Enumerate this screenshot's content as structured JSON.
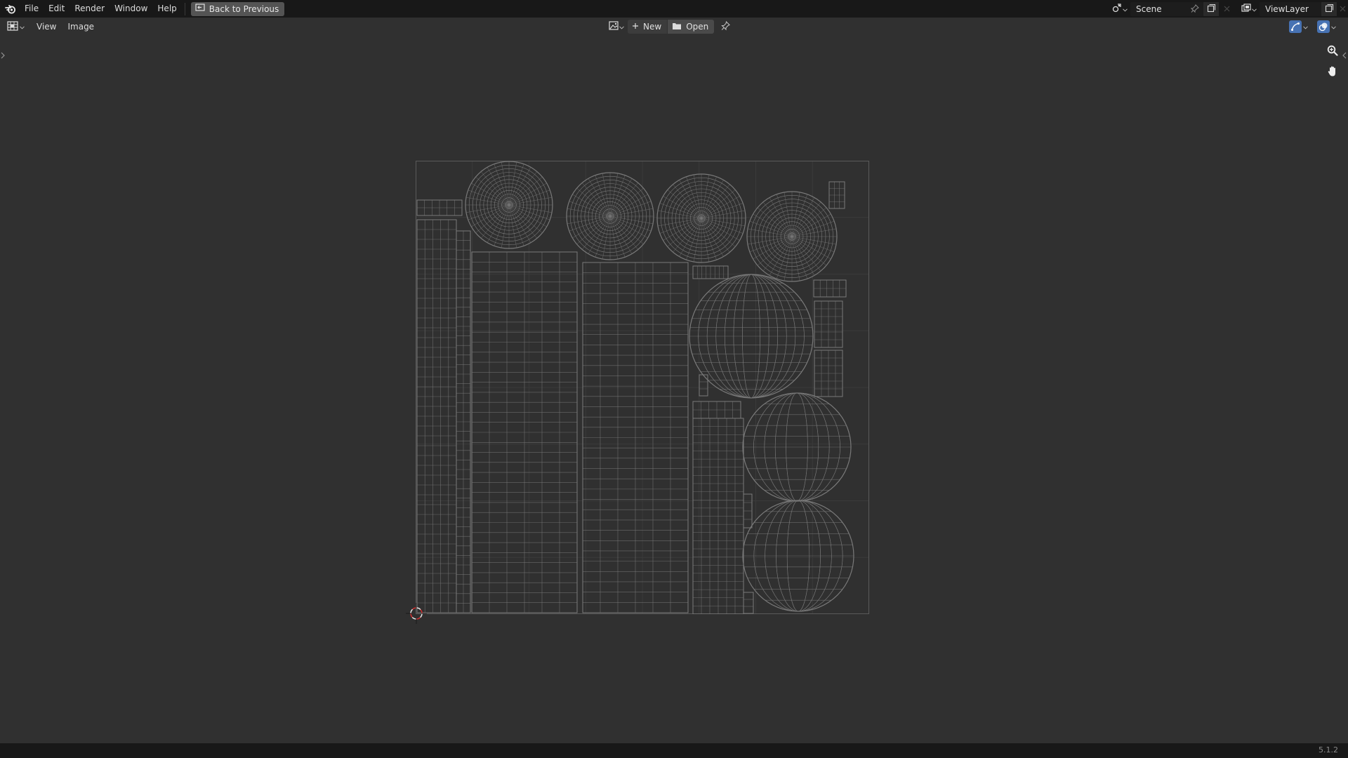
{
  "topbar": {
    "menus": [
      "File",
      "Edit",
      "Render",
      "Window",
      "Help"
    ],
    "back_label": "Back to Previous",
    "scene_name": "Scene",
    "view_layer": "ViewLayer"
  },
  "editor_header": {
    "menus": [
      "View",
      "Image"
    ],
    "new_label": "New",
    "open_label": "Open"
  },
  "statusbar": {
    "version": "5.1.2"
  },
  "colors": {
    "accent_blue": "#4772b3",
    "wire": "#7a7a7a"
  },
  "icons": {
    "logo": "blender-logo-icon",
    "back": "screen-back-icon",
    "scene": "scene-icon",
    "view_layer": "render-layers-icon",
    "zoom": "zoom-icon",
    "pan": "hand-icon"
  }
}
